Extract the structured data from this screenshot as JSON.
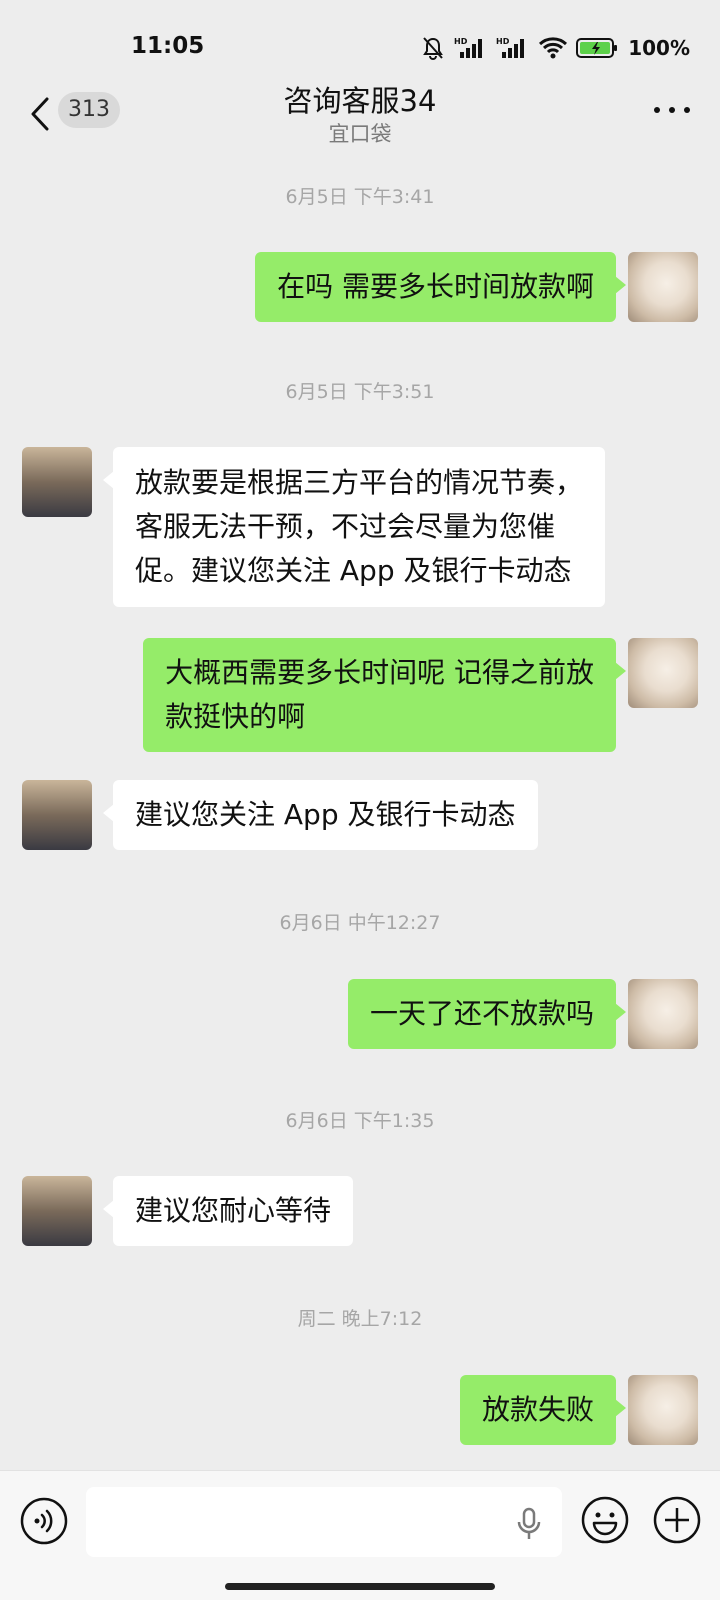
{
  "status_bar": {
    "time": "11:05",
    "battery": "100%",
    "icons": [
      "bell-off-icon",
      "hd-signal-icon",
      "hd-signal-icon",
      "wifi-icon",
      "battery-charging-icon"
    ]
  },
  "header": {
    "unread_count": "313",
    "title": "咨询客服34",
    "subtitle": "宜口袋"
  },
  "messages": [
    {
      "type": "timestamp",
      "text": "6月5日 下午3:41"
    },
    {
      "type": "out",
      "lines": [
        "在吗 需要多长时间放款啊"
      ]
    },
    {
      "type": "timestamp",
      "text": "6月5日 下午3:51"
    },
    {
      "type": "in",
      "lines": [
        "放款要是根据三方平台的情况节奏，",
        "客服无法干预，不过会尽量为您催",
        "促。建议您关注 App 及银行卡动态"
      ]
    },
    {
      "type": "out",
      "lines": [
        "大概西需要多长时间呢 记得之前放",
        "款挺快的啊"
      ]
    },
    {
      "type": "in",
      "lines": [
        "建议您关注 App 及银行卡动态"
      ]
    },
    {
      "type": "timestamp",
      "text": "6月6日 中午12:27"
    },
    {
      "type": "out",
      "lines": [
        "一天了还不放款吗"
      ]
    },
    {
      "type": "timestamp",
      "text": "6月6日 下午1:35"
    },
    {
      "type": "in",
      "lines": [
        "建议您耐心等待"
      ]
    },
    {
      "type": "timestamp",
      "text": "周二 晚上7:12"
    },
    {
      "type": "out",
      "lines": [
        "放款失败"
      ]
    }
  ],
  "input_bar": {
    "icons": [
      "voice-icon",
      "mic-icon",
      "emoji-icon",
      "plus-icon"
    ]
  },
  "colors": {
    "background": "#ededed",
    "outgoing_bubble": "#95ec69",
    "incoming_bubble": "#ffffff",
    "timestamp_text": "#a6a6a6"
  }
}
